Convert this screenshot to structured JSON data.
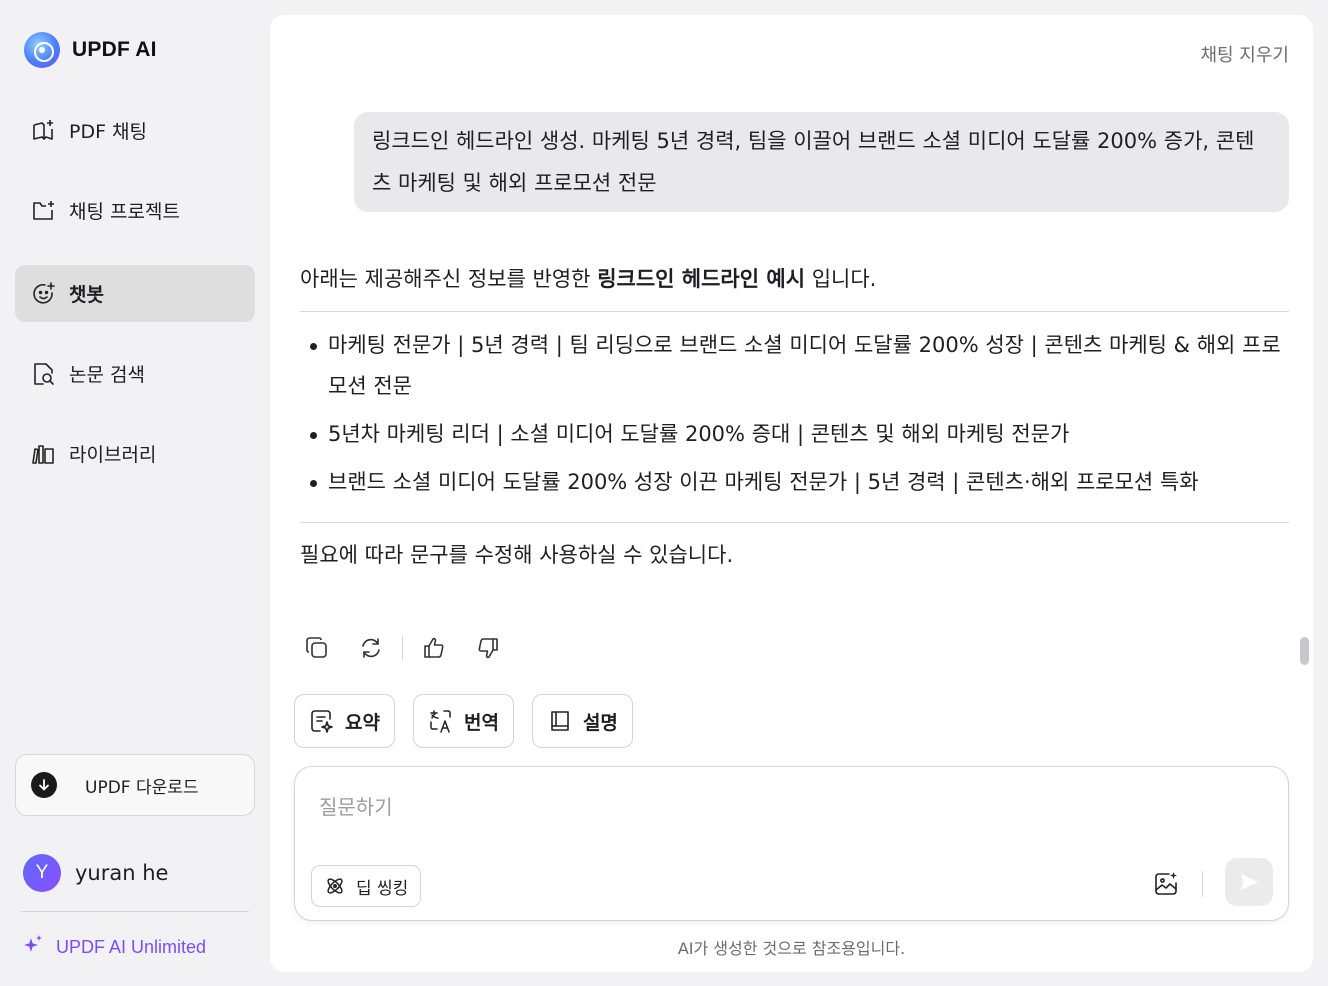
{
  "app": {
    "title": "UPDF AI"
  },
  "sidebar": {
    "items": [
      {
        "label": "PDF 채팅",
        "icon": "book-sparkle-icon",
        "active": false
      },
      {
        "label": "채팅 프로젝트",
        "icon": "folder-sparkle-icon",
        "active": false
      },
      {
        "label": "챗봇",
        "icon": "chatbot-face-icon",
        "active": true
      },
      {
        "label": "논문 검색",
        "icon": "document-search-icon",
        "active": false
      },
      {
        "label": "라이브러리",
        "icon": "library-books-icon",
        "active": false
      }
    ],
    "download_label": "UPDF 다운로드",
    "user": {
      "initial": "Y",
      "name": "yuran he"
    },
    "plan_label": "UPDF AI Unlimited"
  },
  "header": {
    "clear_chat_label": "채팅 지우기"
  },
  "conversation": {
    "user_message": "링크드인 헤드라인 생성. 마케팅 5년 경력, 팀을 이끌어 브랜드 소셜 미디어 도달률 200% 증가, 콘텐츠 마케팅 및 해외 프로모션 전문",
    "answer": {
      "intro_before": "아래는 제공해주신 정보를 반영한 ",
      "intro_bold": "링크드인 헤드라인 예시",
      "intro_after": " 입니다.",
      "bullets": [
        "마케팅 전문가 | 5년 경력 | 팀 리딩으로 브랜드 소셜 미디어 도달률 200% 성장 | 콘텐츠 마케팅 & 해외 프로모션 전문",
        "5년차 마케팅 리더 | 소셜 미디어 도달률 200% 증대 | 콘텐츠 및 해외 마케팅 전문가",
        "브랜드 소셜 미디어 도달률 200% 성장 이끈 마케팅 전문가 | 5년 경력 | 콘텐츠·해외 프로모션 특화"
      ],
      "outro": "필요에 따라 문구를 수정해 사용하실 수 있습니다."
    },
    "actions": [
      "copy-icon",
      "regenerate-icon",
      "thumbs-up-icon",
      "thumbs-down-icon"
    ]
  },
  "quick_actions": [
    {
      "label": "요약",
      "icon": "summary-icon"
    },
    {
      "label": "번역",
      "icon": "translate-icon"
    },
    {
      "label": "설명",
      "icon": "book-icon"
    }
  ],
  "input": {
    "placeholder": "질문하기",
    "deep_think_label": "딥 씽킹",
    "disclaimer": "AI가 생성한 것으로 참조용입니다."
  },
  "colors": {
    "accent": "#7b4dff",
    "active_nav_bg": "#dededf",
    "bubble_bg": "#e9e9eb"
  }
}
